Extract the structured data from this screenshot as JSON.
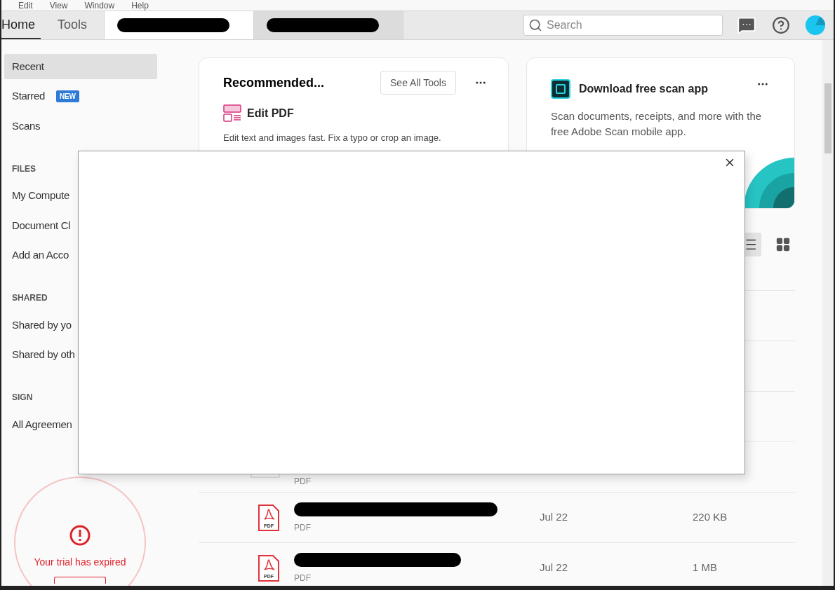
{
  "menu_bar": [
    "Edit",
    "View",
    "Window",
    "Help"
  ],
  "tabs": [
    {
      "label": "Home",
      "selected": true
    },
    {
      "label": "Tools",
      "selected": false
    }
  ],
  "document_tabs": [
    {
      "selected": true
    },
    {
      "selected": false
    }
  ],
  "search": {
    "placeholder": "Search"
  },
  "sidebar": {
    "groups": [
      {
        "items": [
          {
            "label": "Recent",
            "selected": true
          },
          {
            "label": "Starred",
            "selected": false,
            "badge": "NEW"
          },
          {
            "label": "Scans",
            "selected": false
          }
        ]
      },
      {
        "heading": "FILES",
        "items": [
          {
            "label": "My Compute",
            "selected": false
          },
          {
            "label": "Document Cl",
            "selected": false
          },
          {
            "label": "Add an Acco",
            "selected": false
          }
        ]
      },
      {
        "heading": "SHARED",
        "items": [
          {
            "label": "Shared by yo",
            "selected": false
          },
          {
            "label": "Shared by oth",
            "selected": false
          }
        ]
      },
      {
        "heading": "SIGN",
        "items": [
          {
            "label": "All Agreemen",
            "selected": false
          }
        ]
      }
    ]
  },
  "trial": {
    "message": "Your trial has expired"
  },
  "recommended_card": {
    "title": "Recommended...",
    "button": "See All Tools",
    "tool": {
      "name": "Edit PDF",
      "description": "Edit text and images fast. Fix a typo or crop an image."
    }
  },
  "scan_card": {
    "title": "Download free scan app",
    "description": "Scan documents, receipts, and more with the free Adobe Scan mobile app."
  },
  "view_toggle": [
    {
      "kind": "list",
      "selected": true
    },
    {
      "kind": "grid",
      "selected": false
    }
  ],
  "files": [
    {
      "kind": "scan",
      "type": "PDF"
    },
    {
      "kind": "pdf",
      "icon_label": "PDF",
      "type": "PDF",
      "date": "Jul 22",
      "size": "220 KB"
    },
    {
      "kind": "pdf",
      "icon_label": "PDF",
      "type": "PDF",
      "date": "Jul 22",
      "size": "1 MB"
    }
  ]
}
